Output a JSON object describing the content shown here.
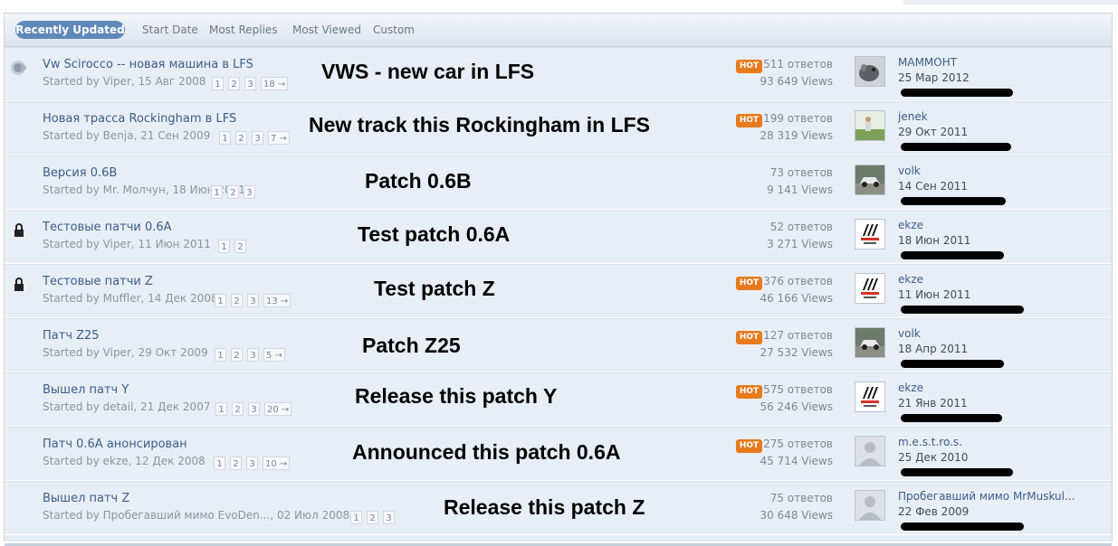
{
  "tabs": [
    "Recently Updated",
    "Start Date",
    "Most Replies",
    "Most Viewed",
    "Custom"
  ],
  "hot_label": "HOT",
  "rows": [
    {
      "title": "Vw Scirocco -- новая машина в LFS",
      "meta": "Started by Viper, 15 Авг 2008",
      "pages": [
        "1",
        "2",
        "3",
        "18 →"
      ],
      "overlay": "VWS - new car in LFS",
      "hot": true,
      "replies": "511 ответов",
      "views": "93 649 Views",
      "user": "МАММОНТ",
      "date": "25 Мар 2012",
      "avatar": "creature-photo",
      "status": "unread"
    },
    {
      "title": "Новая трасса Rockingham в LFS",
      "meta": "Started by Benja, 21 Сен 2009",
      "pages": [
        "1",
        "2",
        "3",
        "7 →"
      ],
      "overlay": "New track this Rockingham in LFS",
      "hot": true,
      "replies": "199 ответов",
      "views": "28 319 Views",
      "user": "jenek",
      "date": "29 Окт 2011",
      "avatar": "outdoor-person-photo",
      "status": "none"
    },
    {
      "title": "Версия 0.6B",
      "meta": "Started by Mr. Молчун, 18 Июн 2011",
      "pages": [
        "1",
        "2",
        "3"
      ],
      "overlay": "Patch 0.6B",
      "hot": false,
      "replies": "73 ответов",
      "views": "9 141 Views",
      "user": "volk",
      "date": "14 Сен 2011",
      "avatar": "car-photo",
      "status": "none"
    },
    {
      "title": "Тестовые патчи 0.6A",
      "meta": "Started by Viper, 11 Июн 2011",
      "pages": [
        "1",
        "2"
      ],
      "overlay": "Test patch 0.6A",
      "hot": false,
      "replies": "52 ответов",
      "views": "3 271 Views",
      "user": "ekze",
      "date": "18 Июн 2011",
      "avatar": "aspec-logo",
      "status": "locked"
    },
    {
      "title": "Тестовые патчи Z",
      "meta": "Started by Muffler, 14 Дек 2008",
      "pages": [
        "1",
        "2",
        "3",
        "13 →"
      ],
      "overlay": "Test patch Z",
      "hot": true,
      "replies": "376 ответов",
      "views": "46 166 Views",
      "user": "ekze",
      "date": "11 Июн 2011",
      "avatar": "aspec-logo",
      "status": "locked"
    },
    {
      "title": "Патч Z25",
      "meta": "Started by Viper, 29 Окт 2009",
      "pages": [
        "1",
        "2",
        "3",
        "5 →"
      ],
      "overlay": "Patch Z25",
      "hot": true,
      "replies": "127 ответов",
      "views": "27 532 Views",
      "user": "volk",
      "date": "18 Апр 2011",
      "avatar": "car-photo",
      "status": "none"
    },
    {
      "title": "Вышел патч Y",
      "meta": "Started by detail, 21 Дек 2007",
      "pages": [
        "1",
        "2",
        "3",
        "20 →"
      ],
      "overlay": "Release this patch Y",
      "hot": true,
      "replies": "575 ответов",
      "views": "56 246 Views",
      "user": "ekze",
      "date": "21 Янв 2011",
      "avatar": "aspec-logo",
      "status": "none"
    },
    {
      "title": "Патч 0.6A анонсирован",
      "meta": "Started by ekze, 12 Дек 2008",
      "pages": [
        "1",
        "2",
        "3",
        "10 →"
      ],
      "overlay": "Announced this patch 0.6A",
      "hot": true,
      "replies": "275 ответов",
      "views": "45 714 Views",
      "user": "m.e.s.t.ro.s.",
      "date": "25 Дек 2010",
      "avatar": "default-user",
      "status": "none"
    },
    {
      "title": "Вышел патч Z",
      "meta": "Started by Пробегавший мимо EvoDen..., 02 Июл 2008",
      "pages": [
        "1",
        "2",
        "3"
      ],
      "overlay": "Release this patch Z",
      "hot": false,
      "replies": "75 ответов",
      "views": "30 648 Views",
      "user": "Пробегавший мимо MrMuskul...",
      "date": "22 Фев 2009",
      "avatar": "default-user",
      "status": "none"
    }
  ]
}
